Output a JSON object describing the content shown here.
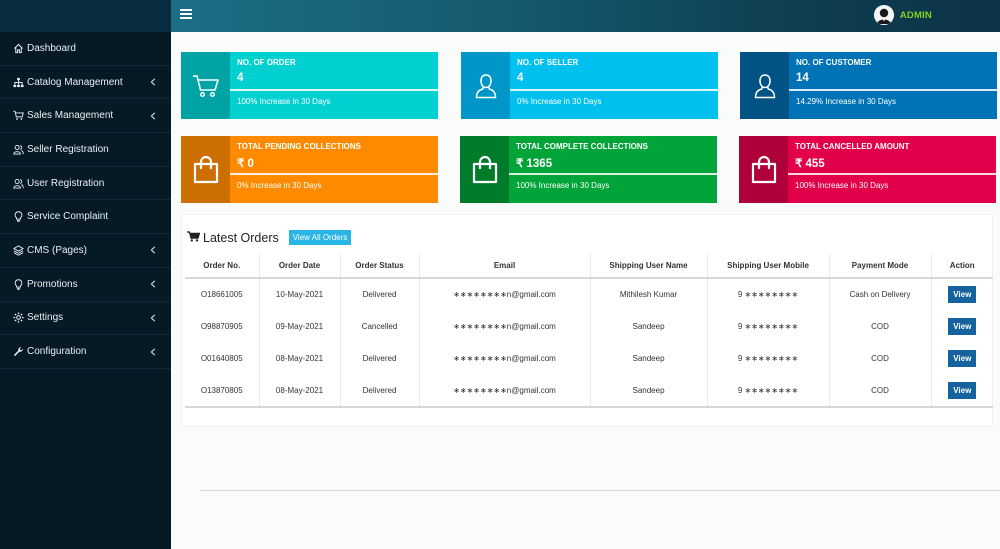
{
  "header": {
    "admin_label": "ADMIN"
  },
  "sidebar": {
    "items": [
      {
        "label": "Dashboard",
        "icon": "home-icon",
        "has_submenu": false
      },
      {
        "label": "Catalog Management",
        "icon": "sitemap-icon",
        "has_submenu": true
      },
      {
        "label": "Sales Management",
        "icon": "cart-icon",
        "has_submenu": true
      },
      {
        "label": "Seller Registration",
        "icon": "users-icon",
        "has_submenu": false
      },
      {
        "label": "User Registration",
        "icon": "users-icon",
        "has_submenu": false
      },
      {
        "label": "Service Complaint",
        "icon": "bulb-icon",
        "has_submenu": false
      },
      {
        "label": "CMS (Pages)",
        "icon": "layers-icon",
        "has_submenu": true
      },
      {
        "label": "Promotions",
        "icon": "bulb-icon",
        "has_submenu": true
      },
      {
        "label": "Settings",
        "icon": "gear-icon",
        "has_submenu": true
      },
      {
        "label": "Configuration",
        "icon": "wrench-icon",
        "has_submenu": true
      }
    ]
  },
  "cards": [
    {
      "title": "NO. OF ORDER",
      "value": "4",
      "footer": "100% Increase in 30 Days",
      "icon": "cart-icon",
      "color": "#00d0d0",
      "icon_bg": "#00a3a3"
    },
    {
      "title": "NO. OF SELLER",
      "value": "4",
      "footer": "0% Increase in 30 Days",
      "icon": "user-icon",
      "color": "#00c0ef",
      "icon_bg": "#0097c8"
    },
    {
      "title": "NO. OF CUSTOMER",
      "value": "14",
      "footer": "14.29% Increase in 30 Days",
      "icon": "user-icon",
      "color": "#0073b7",
      "icon_bg": "#005384"
    },
    {
      "title": "TOTAL PENDING COLLECTIONS",
      "value": "₹ 0",
      "footer": "0% Increase in 30 Days",
      "icon": "bag-icon",
      "color": "#ff8a00",
      "icon_bg": "#cc6e00"
    },
    {
      "title": "TOTAL COMPLETE COLLECTIONS",
      "value": "₹ 1365",
      "footer": "100% Increase in 30 Days",
      "icon": "bag-icon",
      "color": "#00a438",
      "icon_bg": "#007b2a"
    },
    {
      "title": "TOTAL CANCELLED AMOUNT",
      "value": "₹ 455",
      "footer": "100% Increase in 30 Days",
      "icon": "bag-icon",
      "color": "#e3004a",
      "icon_bg": "#b0003a"
    }
  ],
  "orders": {
    "title": "Latest Orders",
    "view_all_label": "View All Orders",
    "columns": [
      "Order No.",
      "Order Date",
      "Order Status",
      "Email",
      "Shipping User Name",
      "Shipping User Mobile",
      "Payment Mode",
      "Action"
    ],
    "rows": [
      {
        "order_no": "O18661005",
        "date": "10-May-2021",
        "status": "Delivered",
        "email": "∗∗∗∗∗∗∗∗n@gmail.com",
        "name": "Mithilesh Kumar",
        "mobile": "9 ∗∗∗∗∗∗∗∗",
        "payment": "Cash on Delivery",
        "action": "View"
      },
      {
        "order_no": "O98870905",
        "date": "09-May-2021",
        "status": "Cancelled",
        "email": "∗∗∗∗∗∗∗∗n@gmail.com",
        "name": "Sandeep",
        "mobile": "9 ∗∗∗∗∗∗∗∗",
        "payment": "COD",
        "action": "View"
      },
      {
        "order_no": "O01640805",
        "date": "08-May-2021",
        "status": "Delivered",
        "email": "∗∗∗∗∗∗∗∗n@gmail.com",
        "name": "Sandeep",
        "mobile": "9 ∗∗∗∗∗∗∗∗",
        "payment": "COD",
        "action": "View"
      },
      {
        "order_no": "O13870805",
        "date": "08-May-2021",
        "status": "Delivered",
        "email": "∗∗∗∗∗∗∗∗n@gmail.com",
        "name": "Sandeep",
        "mobile": "9 ∗∗∗∗∗∗∗∗",
        "payment": "COD",
        "action": "View"
      }
    ]
  },
  "colors": {
    "sidebar_bg": "#061a26",
    "admin_text": "#7ed321",
    "view_button": "#14629e",
    "view_all_button": "#29b6e6"
  }
}
